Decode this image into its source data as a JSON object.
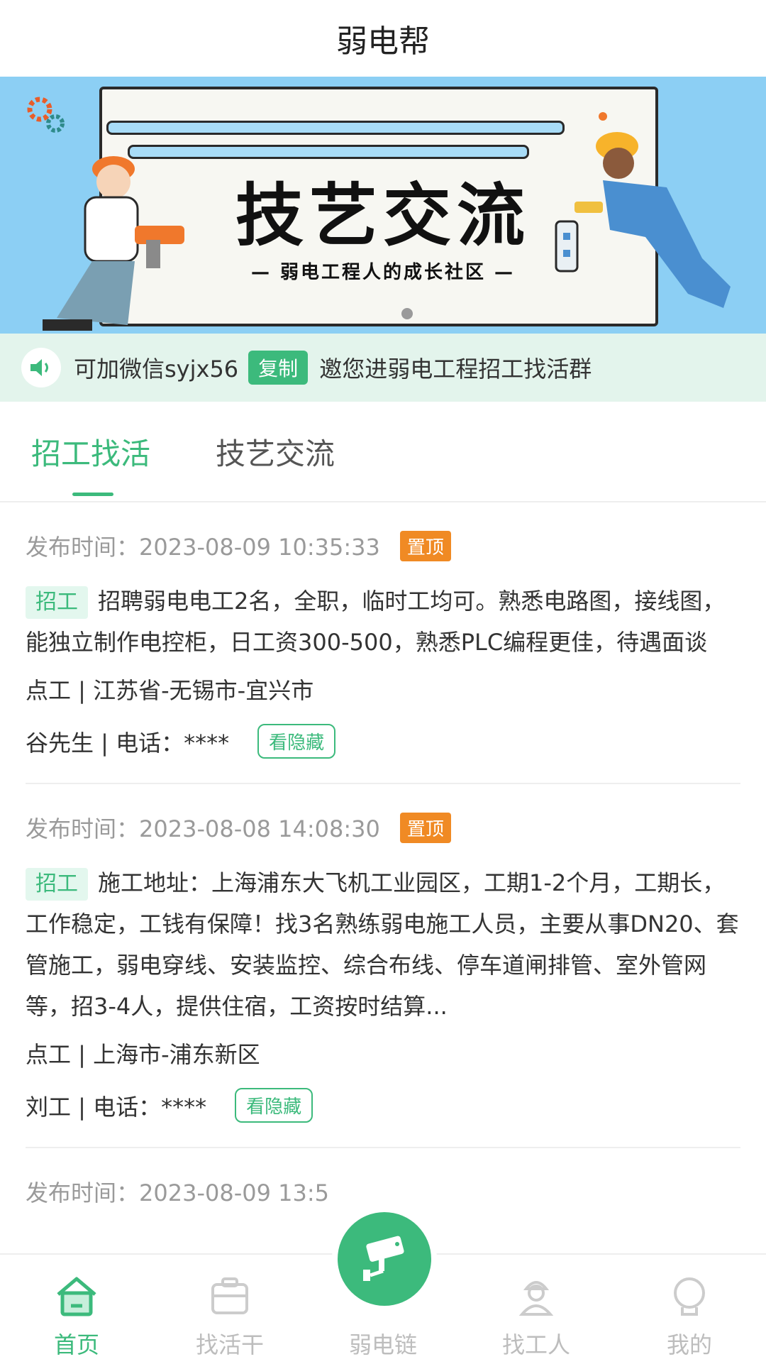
{
  "header": {
    "title": "弱电帮"
  },
  "banner": {
    "title": "技艺交流",
    "subtitle": "— 弱电工程人的成长社区 —"
  },
  "notice": {
    "text_before": "可加微信syjx56",
    "copy_label": "复制",
    "text_after": "邀您进弱电工程招工找活群"
  },
  "tabs": [
    {
      "label": "招工找活",
      "active": true
    },
    {
      "label": "技艺交流",
      "active": false
    }
  ],
  "posts": [
    {
      "time": "发布时间：2023-08-09 10:35:33",
      "pin_label": "置顶",
      "tag": "招工",
      "description": "招聘弱电电工2名，全职，临时工均可。熟悉电路图，接线图，能独立制作电控柜，日工资300-500，熟悉PLC编程更佳，待遇面谈",
      "location": "点工 | 江苏省-无锡市-宜兴市",
      "contact": "谷先生 | 电话：****",
      "reveal_label": "看隐藏"
    },
    {
      "time": "发布时间：2023-08-08 14:08:30",
      "pin_label": "置顶",
      "tag": "招工",
      "description": "施工地址：上海浦东大飞机工业园区，工期1-2个月，工期长，工作稳定，工钱有保障！找3名熟练弱电施工人员，主要从事DN20、套管施工，弱电穿线、安装监控、综合布线、停车道闸排管、室外管网等，招3-4人，提供住宿，工资按时结算...",
      "location": "点工 | 上海市-浦东新区",
      "contact": "刘工 | 电话：****",
      "reveal_label": "看隐藏"
    },
    {
      "time": "发布时间：2023-08-09 13:5"
    }
  ],
  "bottom_nav": [
    {
      "label": "首页",
      "icon": "home-icon",
      "active": true
    },
    {
      "label": "找活干",
      "icon": "briefcase-icon",
      "active": false
    },
    {
      "label": "弱电链",
      "icon": "camera-icon",
      "active": false
    },
    {
      "label": "找工人",
      "icon": "worker-icon",
      "active": false
    },
    {
      "label": "我的",
      "icon": "user-icon",
      "active": false
    }
  ],
  "colors": {
    "accent": "#3cba7c",
    "pin": "#f08a24",
    "notice_bg": "#e3f4ec"
  }
}
